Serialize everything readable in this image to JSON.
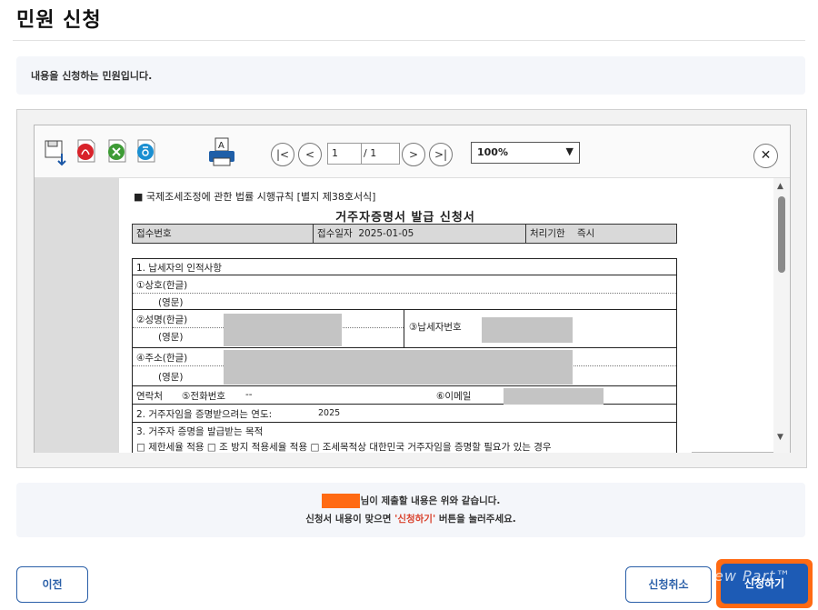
{
  "page": {
    "title": "민원 신청",
    "intro": "내용을 신청하는 민원입니다."
  },
  "viewer": {
    "toolbar": {
      "page_current": "1",
      "page_total": "/ 1",
      "zoom": "100%",
      "zoom_options": [
        "100%"
      ],
      "icons": [
        "save-icon",
        "pdf-icon",
        "excel-icon",
        "hwp-icon",
        "print-icon",
        "first-page-icon",
        "prev-page-icon",
        "next-page-icon",
        "last-page-icon",
        "close-icon"
      ]
    },
    "document": {
      "caption": "■ 국제조세조정에 관한 법률 시행규칙 [별지 제38호서식]",
      "title": "거주자증명서 발급 신청서",
      "header": {
        "receipt_no_label": "접수번호",
        "receipt_date_label": "접수일자",
        "receipt_date_value": "2025-01-05",
        "deadline_label": "처리기한",
        "deadline_value": "즉시"
      },
      "section1_title": "1. 납세자의 인적사항",
      "company_kor": "①상호(한글)",
      "company_eng": "(영문)",
      "name_kor": "②성명(한글)",
      "name_eng": "(영문)",
      "taxpayer_no": "③납세자번호",
      "address_kor": "④주소(한글)",
      "address_eng": "(영문)",
      "contact_label": "연락처",
      "phone_label": "⑤전화번호",
      "phone_value": "--",
      "email_label": "⑥이메일",
      "section2_title": "2. 거주자임을 증명받으려는 연도:",
      "section2_value": "2025",
      "section3_title": "3. 거주자 증명을 발급받는 목적",
      "section3_partial": "□ 제한세율 적용  □ 조 방지 적용세율 적용  □ 조세목적상 대한민국 거주자임을 증명할 필요가 있는 경우"
    }
  },
  "notice": {
    "line1_suffix": "님이 제출할 내용은 위와 같습니다.",
    "line2_prefix": "신청서 내용이 맞으면 ",
    "line2_highlight": "'신청하기'",
    "line2_suffix": " 버튼을 눌러주세요."
  },
  "buttons": {
    "prev": "이전",
    "cancel": "신청취소",
    "submit": "신청하기"
  },
  "watermark": "ew Part™",
  "colors": {
    "accent_blue": "#1d5bb5",
    "outline_blue": "#2a5fa8",
    "highlight_orange": "#ff6a13",
    "notice_red": "#d9432e"
  }
}
